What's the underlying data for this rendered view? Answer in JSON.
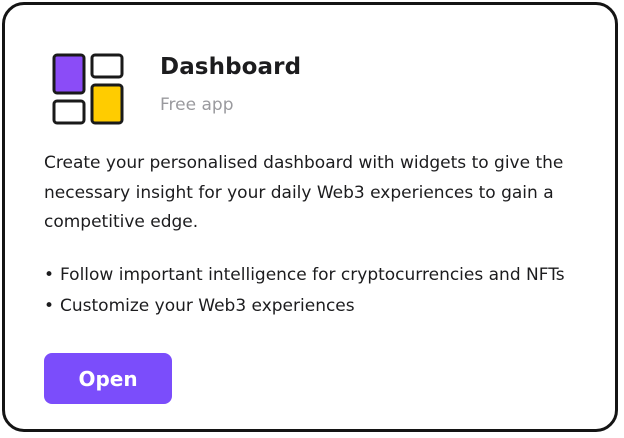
{
  "app": {
    "icon": "dashboard-widgets-icon",
    "title": "Dashboard",
    "subtitle": "Free app"
  },
  "description": "Create your personalised dashboard with widgets to give the necessary insight for your daily Web3 experiences to gain a competitive edge.",
  "features": [
    {
      "bullet": "•",
      "text": "Follow important intelligence for cryptocurrencies and NFTs"
    },
    {
      "bullet": "•",
      "text": "Customize your Web3 experiences"
    }
  ],
  "actions": {
    "open_label": "Open"
  },
  "colors": {
    "accent": "#7b4dfb",
    "icon_purple": "#8b4cf7",
    "icon_yellow": "#ffcc00",
    "border": "#141414",
    "muted_text": "#9a9a9e"
  }
}
